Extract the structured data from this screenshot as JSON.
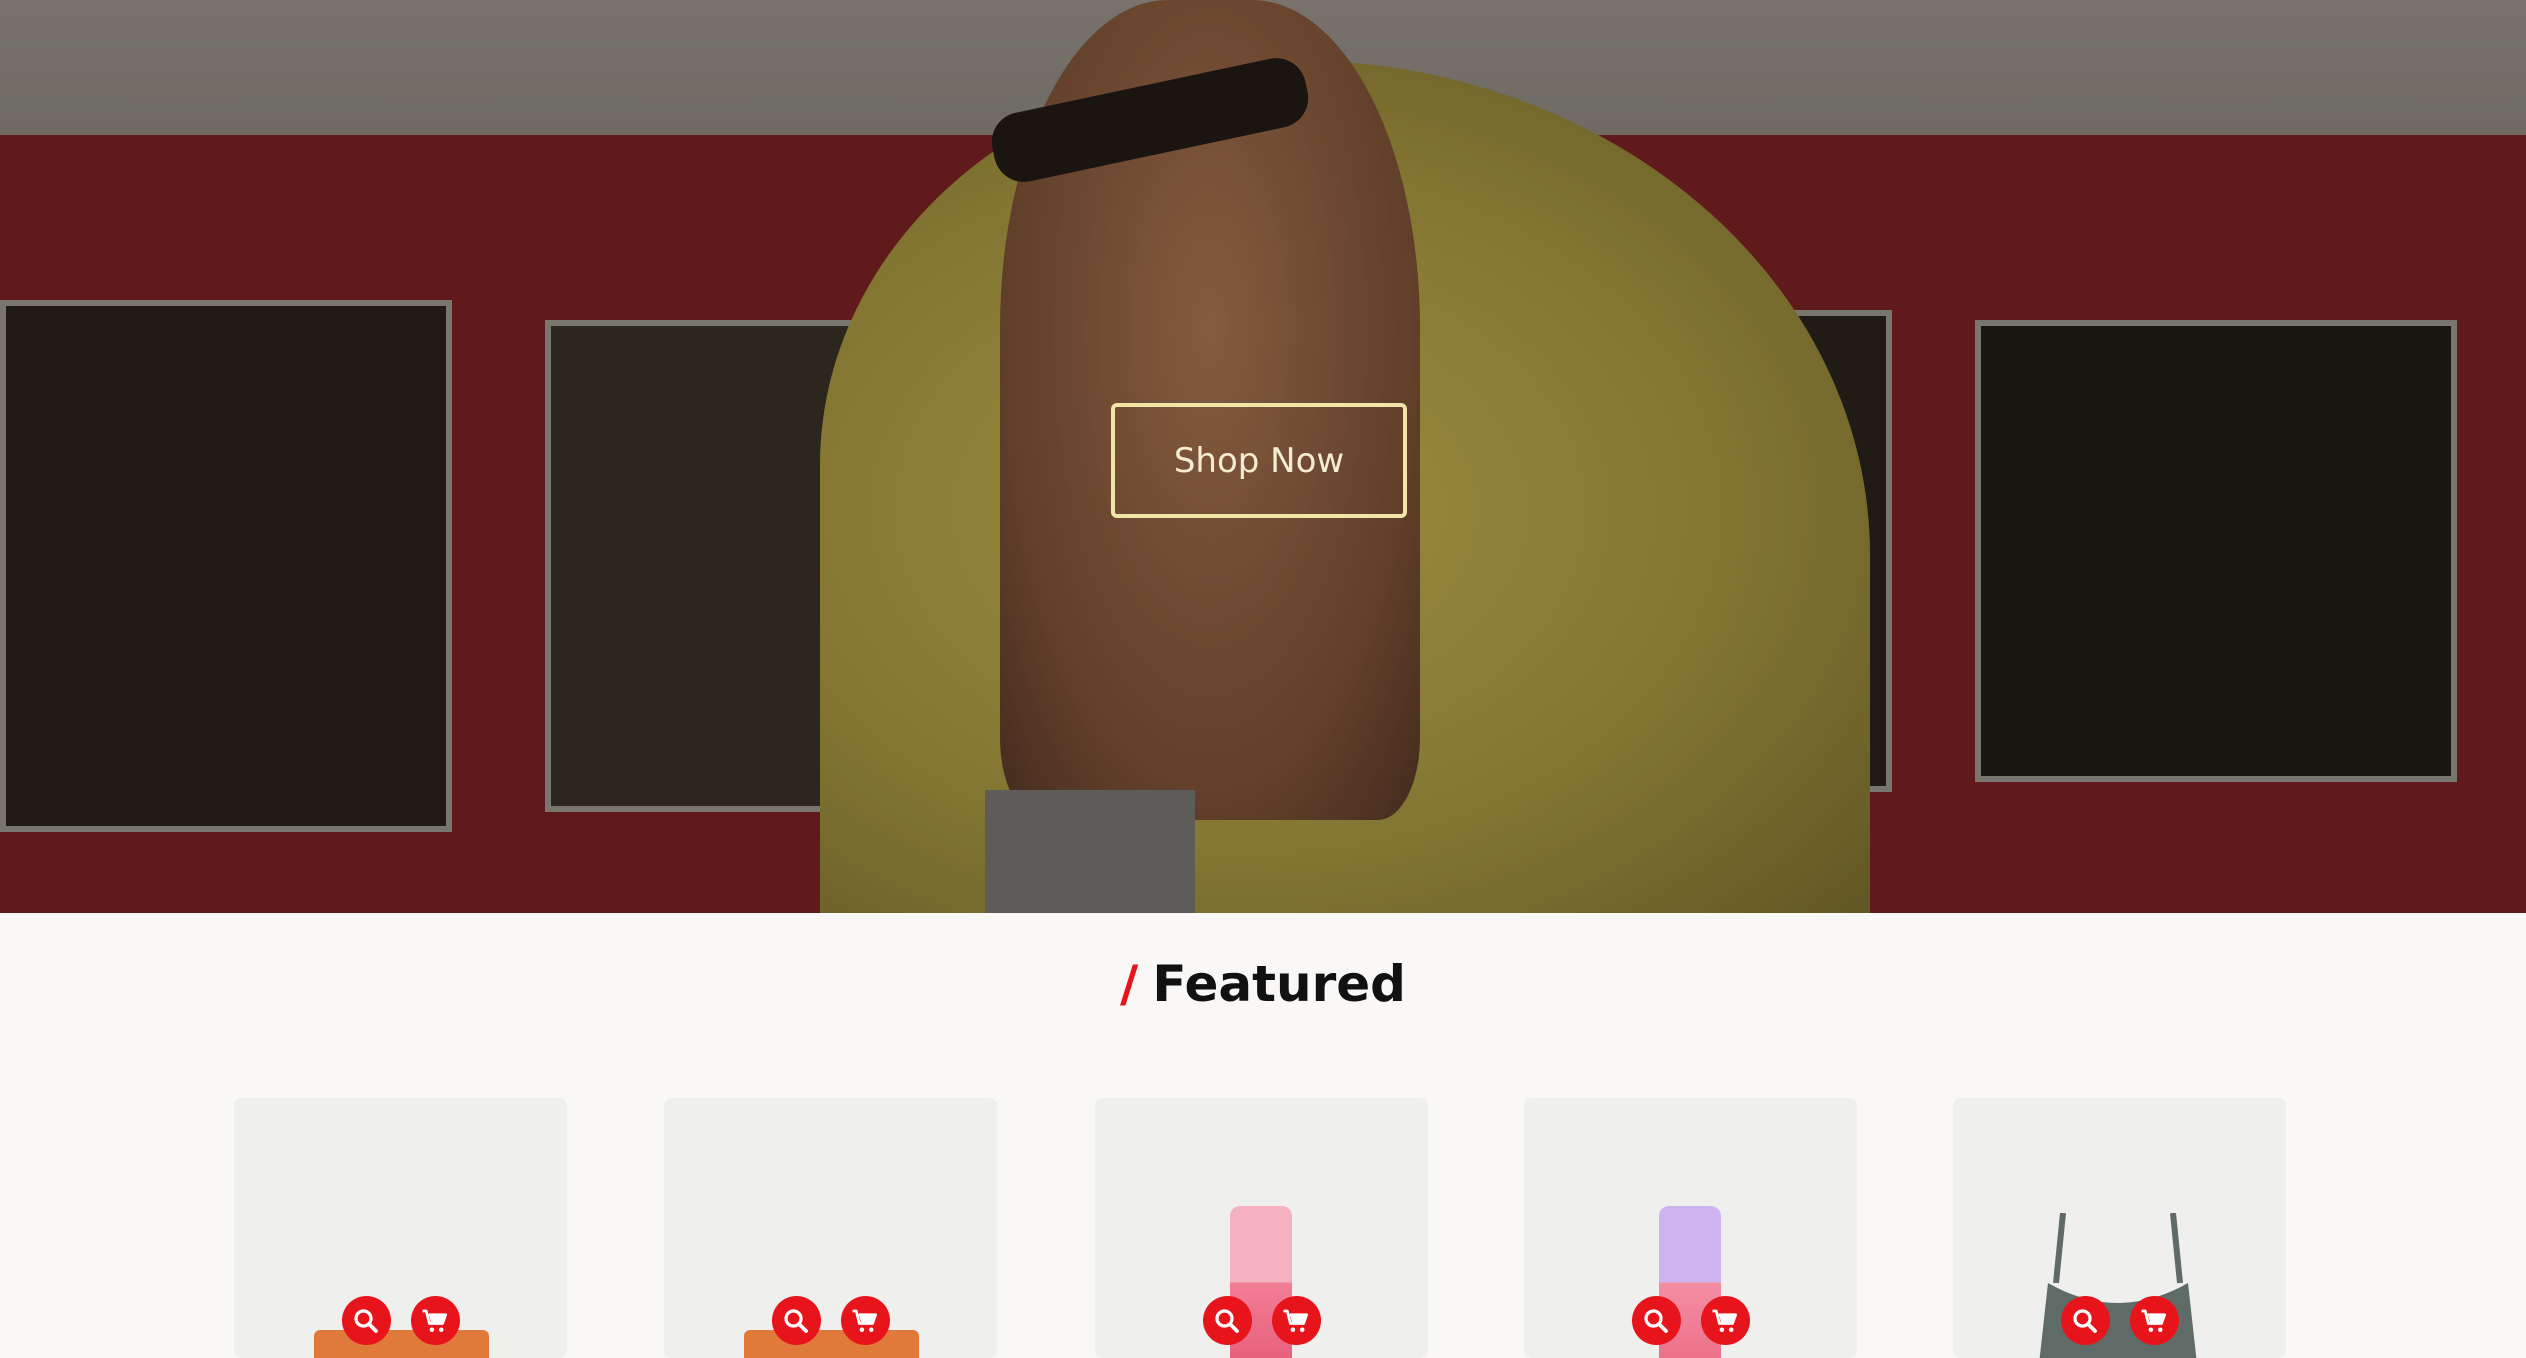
{
  "hero": {
    "cta_label": "Shop Now"
  },
  "featured": {
    "slash": "/",
    "title": "Featured",
    "accent_color": "#e8141c",
    "products": [
      {
        "image": "orange-product-image",
        "actions": [
          "search-icon",
          "cart-icon"
        ]
      },
      {
        "image": "orange-product-image",
        "actions": [
          "search-icon",
          "cart-icon"
        ]
      },
      {
        "image": "pink-bottle-image",
        "actions": [
          "search-icon",
          "cart-icon"
        ]
      },
      {
        "image": "lavender-bottle-image",
        "actions": [
          "search-icon",
          "cart-icon"
        ]
      },
      {
        "image": "grey-tank-top-image",
        "actions": [
          "search-icon",
          "cart-icon"
        ]
      }
    ]
  }
}
